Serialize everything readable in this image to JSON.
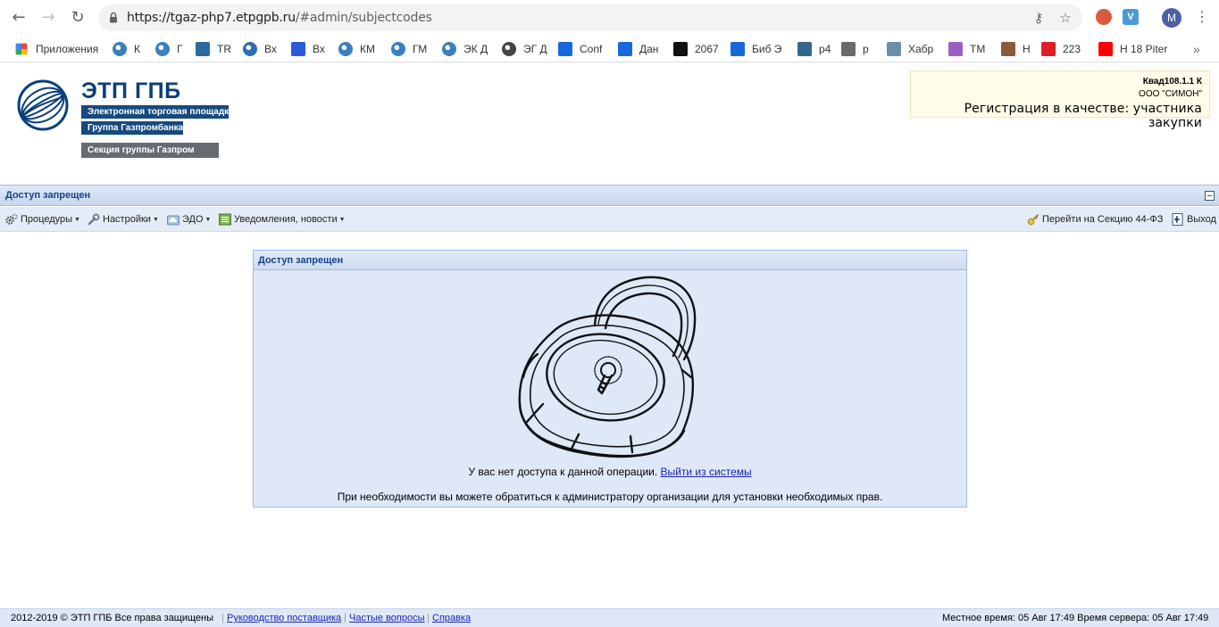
{
  "browser": {
    "url_host": "https://tgaz-php7.etpgpb.ru",
    "url_path": "/#admin/subjectcodes",
    "profile_initial": "M",
    "bookmarks": [
      {
        "label": "Приложения",
        "icon": "apps-icon",
        "color": "#e94335"
      },
      {
        "label": "К",
        "icon": "gazprom-icon",
        "color": "#3a7fc1"
      },
      {
        "label": "Г",
        "icon": "gazprom-icon",
        "color": "#3a7fc1"
      },
      {
        "label": "TR",
        "icon": "trello-icon",
        "color": "#2a6a9e"
      },
      {
        "label": "Вх",
        "icon": "globe-icon",
        "color": "#2f6db5"
      },
      {
        "label": "Вх",
        "icon": "mail-icon",
        "color": "#2a5bd7"
      },
      {
        "label": "КМ",
        "icon": "gazprom-icon",
        "color": "#3a7fc1"
      },
      {
        "label": "ГМ",
        "icon": "gazprom-icon",
        "color": "#3a7fc1"
      },
      {
        "label": "ЭК Д",
        "icon": "gazprom-icon",
        "color": "#3a7fc1"
      },
      {
        "label": "ЭГ Д",
        "icon": "world-icon",
        "color": "#444"
      },
      {
        "label": "Conf",
        "icon": "confluence-icon",
        "color": "#1868db"
      },
      {
        "label": "Дан",
        "icon": "confluence-icon",
        "color": "#1868db"
      },
      {
        "label": "2067",
        "icon": "youtrack-icon",
        "color": "#111"
      },
      {
        "label": "Биб Э",
        "icon": "confluence-icon",
        "color": "#1868db"
      },
      {
        "label": "p4",
        "icon": "postgres-icon",
        "color": "#336791"
      },
      {
        "label": "p",
        "icon": "postgres-icon",
        "color": "#6a6a6a"
      },
      {
        "label": "Хабр",
        "icon": "habr-icon",
        "color": "#6b8fa8"
      },
      {
        "label": "ТМ",
        "icon": "tm-icon",
        "color": "#9c5fc4"
      },
      {
        "label": "Н",
        "icon": "person-icon",
        "color": "#8a5a3a"
      },
      {
        "label": "223",
        "icon": "otc-icon",
        "color": "#e21d2a"
      },
      {
        "label": "Н 18 Piter",
        "icon": "youtube-icon",
        "color": "#ff0000"
      }
    ]
  },
  "header": {
    "logo_title": "ЭТП ГПБ",
    "logo_line1": "Электронная торговая площадка",
    "logo_line2": "Группа Газпромбанка",
    "logo_section": "Секция группы Газпром",
    "user_code": "Квад108.1.1 К",
    "user_org": "ООО \"СИМОН\"",
    "user_role": "Регистрация в качестве: участника закупки"
  },
  "panel": {
    "title": "Доступ запрещен"
  },
  "toolbar": {
    "procedures": "Процедуры",
    "settings": "Настройки",
    "edo": "ЭДО",
    "notifications": "Уведомления, новости",
    "goto_44": "Перейти на Секцию 44-ФЗ",
    "logout": "Выход"
  },
  "dialog": {
    "title": "Доступ запрещен",
    "message_prefix": "У вас нет доступа к данной операции.",
    "logout_link": "Выйти из системы",
    "message2": "При необходимости вы можете обратиться к администратору организации для установки необходимых прав."
  },
  "footer": {
    "copyright": "2012-2019 © ЭТП ГПБ Все права защищены",
    "link_guide": "Руководство поставщика",
    "link_faq": "Частые вопросы",
    "link_help": "Справка",
    "time": "Местное время: 05 Авг 17:49 Время сервера: 05 Авг 17:49"
  }
}
